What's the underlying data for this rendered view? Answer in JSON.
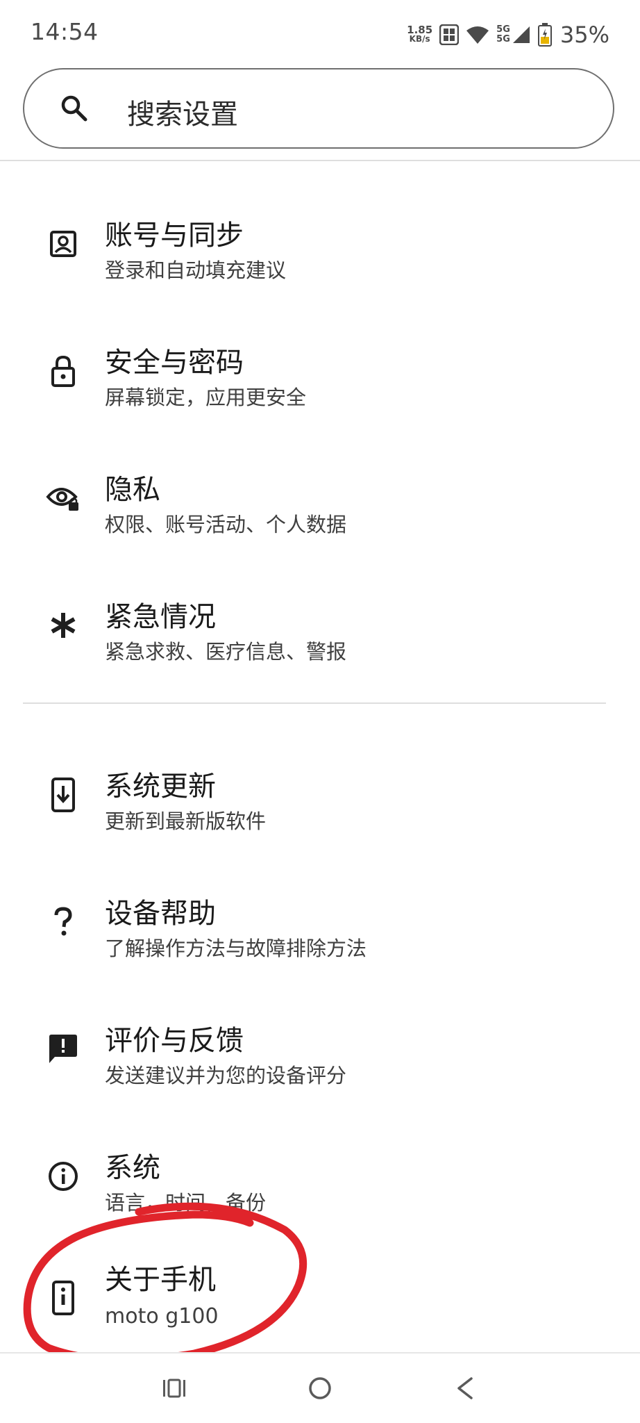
{
  "status_bar": {
    "time": "14:54",
    "net_speed_value": "1.85",
    "net_speed_unit": "KB/s",
    "network_type_1": "5G",
    "network_type_2": "5G",
    "battery_percent": "35%",
    "icons": [
      "hd-icon",
      "wifi-icon",
      "signal-icon",
      "battery-icon"
    ]
  },
  "search": {
    "placeholder": "搜索设置",
    "icon": "search-icon"
  },
  "settings": [
    {
      "id": "accounts",
      "title": "账号与同步",
      "subtitle": "登录和自动填充建议",
      "icon": "account-box-icon"
    },
    {
      "id": "security",
      "title": "安全与密码",
      "subtitle": "屏幕锁定，应用更安全",
      "icon": "lock-icon"
    },
    {
      "id": "privacy",
      "title": "隐私",
      "subtitle": "权限、账号活动、个人数据",
      "icon": "privacy-eye-icon"
    },
    {
      "id": "emergency",
      "title": "紧急情况",
      "subtitle": "紧急求救、医疗信息、警报",
      "icon": "asterisk-icon"
    },
    {
      "id": "system-update",
      "title": "系统更新",
      "subtitle": "更新到最新版软件",
      "icon": "system-update-icon"
    },
    {
      "id": "device-help",
      "title": "设备帮助",
      "subtitle": "了解操作方法与故障排除方法",
      "icon": "question-mark-icon"
    },
    {
      "id": "feedback",
      "title": "评价与反馈",
      "subtitle": "发送建议并为您的设备评分",
      "icon": "feedback-icon"
    },
    {
      "id": "system",
      "title": "系统",
      "subtitle": "语言，时间，备份",
      "icon": "info-icon"
    },
    {
      "id": "about-phone",
      "title": "关于手机",
      "subtitle": "moto g100",
      "icon": "phone-info-icon"
    }
  ],
  "annotation": {
    "color": "#e0242b",
    "shape": "hand-drawn-circle",
    "target": "about-phone"
  },
  "nav_bar": {
    "icons": [
      "recents-icon",
      "home-icon",
      "back-icon"
    ]
  },
  "colors": {
    "icon": "#1f1f1f",
    "divider": "#dedede",
    "text_secondary": "#3f3f3f"
  }
}
